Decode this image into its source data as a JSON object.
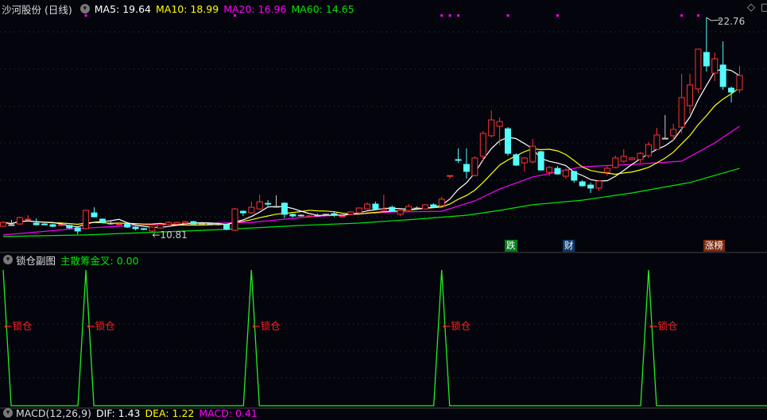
{
  "header": {
    "title": "沙河股份 (日线)",
    "ma5": "MA5: 19.64",
    "ma10": "MA10: 18.99",
    "ma20": "MA20: 16.96",
    "ma60": "MA60: 14.65"
  },
  "sub_panel": {
    "title": "锁仓副图",
    "indicator": "主散筹金叉: 0.00",
    "lock_label": "←锁仓"
  },
  "bottom_panel": {
    "title": "MACD(12,26,9)",
    "dif": "DIF: 1.43",
    "dea": "DEA: 1.22",
    "macd": "MACD: 0.41"
  },
  "markers": [
    {
      "index": 61,
      "text": "跌",
      "color": "#0a7a1e"
    },
    {
      "index": 68,
      "text": "财",
      "color": "#0d3a6b"
    },
    {
      "index": 85,
      "text": "涨榜",
      "color": "#7a2a10"
    }
  ],
  "colors": {
    "up": "#ff3232",
    "down": "#54fcfc",
    "ma5": "#ffffff",
    "ma10": "#ffff00",
    "ma20": "#ff00ff",
    "ma60": "#00e600"
  },
  "chart_data": [
    {
      "type": "candlestick",
      "title": "沙河股份 (日线)",
      "high_label": "22.76",
      "low_label": "10.81",
      "high_index": 85,
      "low_index": 18,
      "ylim": [
        10.2,
        23.3
      ],
      "signal_dot_indices": [
        10,
        28,
        53,
        54,
        55,
        61,
        67,
        82,
        84
      ],
      "ohlc": [
        [
          11.12,
          11.4,
          11.08,
          11.34
        ],
        [
          11.21,
          11.48,
          11.17,
          11.21
        ],
        [
          11.25,
          11.65,
          11.21,
          11.61
        ],
        [
          11.48,
          11.74,
          11.45,
          11.52
        ],
        [
          11.3,
          11.57,
          11.17,
          11.21
        ],
        [
          11.25,
          11.3,
          11.17,
          11.21
        ],
        [
          11.21,
          11.25,
          11.08,
          11.12
        ],
        [
          11.17,
          11.25,
          11.12,
          11.21
        ],
        [
          11.17,
          11.21,
          10.99,
          11.03
        ],
        [
          11.03,
          11.08,
          10.68,
          10.86
        ],
        [
          10.99,
          12.05,
          10.95,
          12.01
        ],
        [
          11.87,
          12.18,
          11.61,
          11.65
        ],
        [
          11.52,
          11.57,
          11.3,
          11.34
        ],
        [
          11.3,
          11.4,
          11.21,
          11.3
        ],
        [
          11.21,
          11.3,
          11.17,
          11.25
        ],
        [
          11.25,
          11.3,
          11.03,
          11.08
        ],
        [
          11.08,
          11.12,
          10.9,
          10.99
        ],
        [
          10.99,
          11.03,
          10.9,
          10.95
        ],
        [
          10.86,
          11.12,
          10.81,
          11.08
        ],
        [
          11.03,
          11.25,
          10.99,
          11.21
        ],
        [
          11.21,
          11.4,
          11.17,
          11.34
        ],
        [
          11.25,
          11.38,
          11.21,
          11.34
        ],
        [
          11.3,
          11.43,
          11.25,
          11.38
        ],
        [
          11.38,
          11.43,
          11.21,
          11.25
        ],
        [
          11.3,
          11.36,
          11.25,
          11.3
        ],
        [
          11.25,
          11.3,
          11.21,
          11.25
        ],
        [
          11.25,
          11.34,
          11.17,
          11.25
        ],
        [
          11.21,
          11.25,
          10.9,
          10.95
        ],
        [
          10.9,
          12.14,
          10.86,
          12.09
        ],
        [
          11.96,
          12.01,
          11.7,
          11.87
        ],
        [
          11.87,
          12.49,
          11.83,
          12.18
        ],
        [
          12.09,
          12.89,
          12.05,
          12.49
        ],
        [
          12.4,
          12.58,
          12.23,
          12.36
        ],
        [
          12.23,
          12.85,
          12.18,
          12.23
        ],
        [
          12.41,
          12.45,
          11.57,
          11.79
        ],
        [
          11.79,
          11.83,
          11.61,
          11.7
        ],
        [
          11.74,
          11.79,
          11.7,
          11.74
        ],
        [
          11.65,
          11.74,
          11.61,
          11.7
        ],
        [
          11.74,
          11.83,
          11.65,
          11.74
        ],
        [
          11.79,
          11.83,
          11.74,
          11.79
        ],
        [
          11.83,
          11.92,
          11.65,
          11.79
        ],
        [
          11.65,
          11.74,
          11.61,
          11.7
        ],
        [
          11.79,
          11.96,
          11.74,
          11.92
        ],
        [
          11.87,
          12.18,
          11.83,
          12.14
        ],
        [
          12.09,
          12.45,
          12.05,
          12.36
        ],
        [
          12.36,
          12.49,
          12.05,
          12.09
        ],
        [
          12.01,
          12.89,
          11.96,
          12.09
        ],
        [
          12.18,
          12.27,
          11.92,
          11.96
        ],
        [
          11.79,
          12.05,
          11.7,
          12.01
        ],
        [
          12.01,
          12.36,
          11.96,
          12.23
        ],
        [
          12.14,
          12.23,
          12.05,
          12.14
        ],
        [
          12.09,
          12.36,
          12.05,
          12.32
        ],
        [
          12.32,
          12.41,
          12.14,
          12.18
        ],
        [
          12.27,
          12.76,
          12.23,
          12.63
        ],
        [
          13.91,
          13.95,
          13.78,
          13.95
        ],
        [
          14.84,
          15.46,
          14.66,
          14.8
        ],
        [
          14.57,
          15.46,
          13.78,
          14.18
        ],
        [
          13.95,
          15.02,
          13.91,
          14.93
        ],
        [
          15.02,
          16.43,
          14.75,
          16.3
        ],
        [
          16.17,
          17.58,
          16.08,
          17.05
        ],
        [
          16.7,
          17.18,
          15.64,
          16.96
        ],
        [
          16.56,
          16.65,
          15.06,
          15.19
        ],
        [
          15.11,
          15.19,
          14.48,
          14.53
        ],
        [
          14.66,
          14.97,
          14.18,
          14.93
        ],
        [
          14.71,
          15.99,
          14.62,
          15.59
        ],
        [
          15.28,
          15.33,
          14.22,
          14.26
        ],
        [
          14.13,
          14.48,
          13.91,
          14.4
        ],
        [
          14.35,
          14.48,
          14.0,
          14.04
        ],
        [
          13.91,
          14.35,
          13.78,
          14.26
        ],
        [
          14.18,
          14.22,
          13.55,
          13.69
        ],
        [
          13.6,
          13.69,
          13.33,
          13.38
        ],
        [
          13.42,
          13.55,
          12.98,
          13.25
        ],
        [
          13.25,
          13.69,
          13.09,
          13.64
        ],
        [
          14.13,
          14.48,
          13.95,
          14.35
        ],
        [
          14.4,
          15.06,
          14.35,
          14.93
        ],
        [
          14.75,
          15.41,
          14.66,
          15.02
        ],
        [
          14.84,
          14.97,
          14.8,
          14.93
        ],
        [
          14.84,
          15.28,
          14.66,
          15.19
        ],
        [
          15.06,
          15.81,
          14.93,
          15.68
        ],
        [
          15.41,
          16.61,
          15.37,
          16.21
        ],
        [
          16.03,
          17.32,
          15.99,
          16.03
        ],
        [
          16.17,
          16.83,
          15.9,
          16.52
        ],
        [
          16.65,
          19.62,
          16.3,
          18.29
        ],
        [
          17.85,
          19.62,
          17.4,
          19.0
        ],
        [
          18.78,
          21.03,
          18.56,
          20.99
        ],
        [
          20.81,
          22.76,
          19.75,
          20.06
        ],
        [
          19.66,
          20.81,
          19.22,
          20.46
        ],
        [
          20.11,
          21.43,
          18.73,
          18.91
        ],
        [
          18.82,
          18.91,
          18.03,
          18.6
        ],
        [
          18.73,
          20.06,
          18.56,
          19.53
        ]
      ],
      "ma20_points": [
        [
          0,
          10.64
        ],
        [
          9,
          11.0
        ],
        [
          16,
          11.17
        ],
        [
          22,
          11.26
        ],
        [
          30,
          11.34
        ],
        [
          37,
          11.65
        ],
        [
          47,
          11.92
        ],
        [
          53,
          11.96
        ],
        [
          57,
          12.54
        ],
        [
          60,
          13.2
        ],
        [
          64,
          13.87
        ],
        [
          70,
          14.44
        ],
        [
          76,
          14.57
        ],
        [
          82,
          14.75
        ],
        [
          86,
          15.77
        ],
        [
          89,
          16.7
        ]
      ],
      "ma60_points": [
        [
          0,
          10.55
        ],
        [
          10,
          10.64
        ],
        [
          27,
          10.95
        ],
        [
          36,
          11.17
        ],
        [
          43,
          11.3
        ],
        [
          50,
          11.52
        ],
        [
          56,
          11.74
        ],
        [
          60,
          12.01
        ],
        [
          64,
          12.32
        ],
        [
          70,
          12.58
        ],
        [
          76,
          12.98
        ],
        [
          83,
          13.56
        ],
        [
          89,
          14.35
        ]
      ]
    },
    {
      "type": "line",
      "title": "锁仓副图",
      "ylim": [
        0,
        100
      ],
      "peak_indices": [
        0,
        10,
        30,
        53,
        78
      ],
      "peak_value": 100,
      "base_value": 0
    }
  ]
}
